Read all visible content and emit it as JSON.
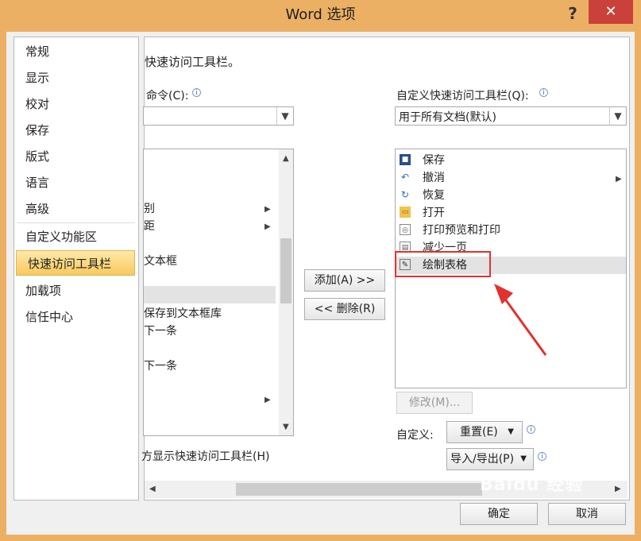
{
  "window": {
    "title": "Word 选项",
    "help": "?",
    "close": "✕"
  },
  "nav": {
    "items": [
      "常规",
      "显示",
      "校对",
      "保存",
      "版式",
      "语言",
      "高级",
      "自定义功能区",
      "快速访问工具栏",
      "加载项",
      "信任中心"
    ],
    "selected": "快速访问工具栏"
  },
  "main": {
    "heading_partial": "快速访问工具栏。",
    "choose_label_partial": "命令(C):",
    "right_label": "自定义快速访问工具栏(Q):",
    "right_combo_value": "用于所有文档(默认)",
    "left_list_partial": [
      "别",
      "距",
      "文本框",
      "保存到文本框库",
      "下一条",
      "下一条"
    ],
    "qat_items": [
      {
        "icon": "save-icon",
        "label": "保存"
      },
      {
        "icon": "undo-icon",
        "label": "撤消"
      },
      {
        "icon": "redo-icon",
        "label": "恢复"
      },
      {
        "icon": "open-folder-icon",
        "label": "打开"
      },
      {
        "icon": "print-preview-icon",
        "label": "打印预览和打印"
      },
      {
        "icon": "shrink-page-icon",
        "label": "减少一页"
      },
      {
        "icon": "draw-table-icon",
        "label": "绘制表格"
      }
    ],
    "add_button": "添加(A) >>",
    "remove_button": "<< 删除(R)",
    "modify_button": "修改(M)...",
    "customize_label": "自定义:",
    "reset_button": "重置(E)",
    "import_export_button": "导入/导出(P)",
    "show_below_partial": "方显示快速访问工具栏(H)"
  },
  "footer": {
    "ok": "确定",
    "cancel": "取消"
  },
  "watermark": "Baidu 经验",
  "colors": {
    "accent_red": "#e0322f",
    "nav_selected": "#f8c95e",
    "title_bar": "#ecb064"
  }
}
